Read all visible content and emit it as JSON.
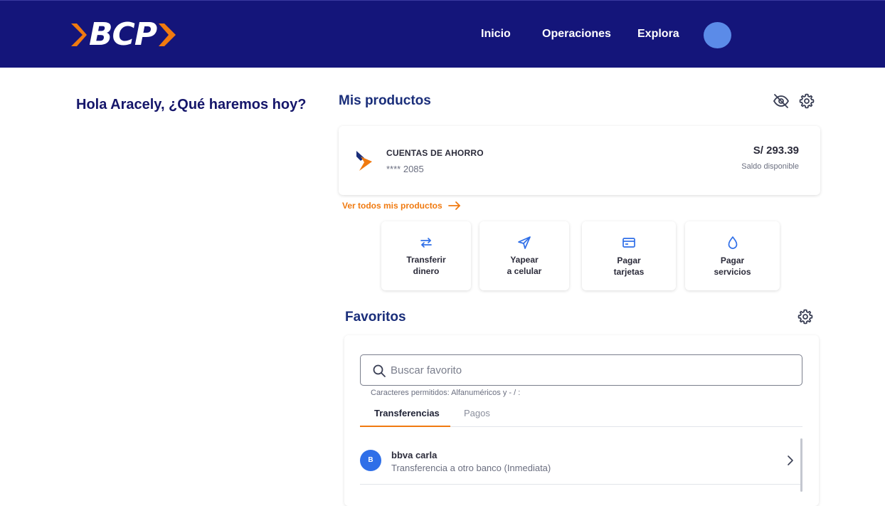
{
  "header": {
    "logo_text": "BCP",
    "nav": [
      "Inicio",
      "Operaciones",
      "Explora"
    ],
    "colors": {
      "bar": "#14157a",
      "brand_orange": "#f07a10",
      "avatar": "#5b8be8"
    }
  },
  "greeting": "Hola Aracely, ¿Qué haremos hoy?",
  "products": {
    "title": "Mis productos",
    "icons": [
      "eye-off-icon",
      "gear-icon"
    ],
    "account": {
      "name": "CUENTAS DE AHORRO",
      "number": "**** 2085",
      "balance": "S/ 293.39",
      "balance_label": "Saldo disponible"
    },
    "see_all": "Ver todos mis productos"
  },
  "actions": [
    {
      "line1": "Transferir",
      "line2": "dinero",
      "icon": "transfer-icon"
    },
    {
      "line1": "Yapear",
      "line2": "a celular",
      "icon": "send-icon"
    },
    {
      "line1": "Pagar",
      "line2": "tarjetas",
      "icon": "card-icon"
    },
    {
      "line1": "Pagar",
      "line2": "servicios",
      "icon": "drop-icon"
    }
  ],
  "favorites": {
    "title": "Favoritos",
    "search_placeholder": "Buscar favorito",
    "search_value": "",
    "hint": "Caracteres permitidos: Alfanuméricos y - / :",
    "tabs": [
      "Transferencias",
      "Pagos"
    ],
    "active_tab": "Transferencias",
    "items": [
      {
        "initial": "B",
        "name": "bbva carla",
        "description": "Transferencia a otro banco (Inmediata)"
      }
    ]
  }
}
